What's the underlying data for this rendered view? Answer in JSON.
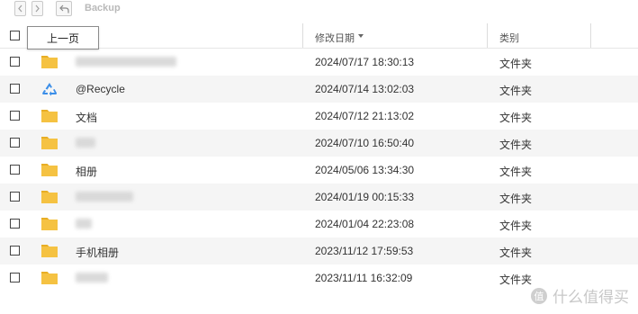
{
  "toolbar": {
    "back_label": "back",
    "forward_label": "forward",
    "up_label": "up",
    "path": "Backup"
  },
  "tooltip": {
    "label": "上一页"
  },
  "header": {
    "modified_label": "修改日期",
    "type_label": "类别"
  },
  "rows": [
    {
      "name": "",
      "date": "2024/07/17 18:30:13",
      "type": "文件夹",
      "icon": "folder-icon",
      "blurred": true
    },
    {
      "name": "@Recycle",
      "date": "2024/07/14 13:02:03",
      "type": "文件夹",
      "icon": "recycle-icon",
      "blurred": false
    },
    {
      "name": "文档",
      "date": "2024/07/12 21:13:02",
      "type": "文件夹",
      "icon": "folder-icon",
      "blurred": false
    },
    {
      "name": "",
      "date": "2024/07/10 16:50:40",
      "type": "文件夹",
      "icon": "folder-icon",
      "blurred": true
    },
    {
      "name": "相册",
      "date": "2024/05/06 13:34:30",
      "type": "文件夹",
      "icon": "folder-icon",
      "blurred": false
    },
    {
      "name": "",
      "date": "2024/01/19 00:15:33",
      "type": "文件夹",
      "icon": "folder-icon",
      "blurred": true
    },
    {
      "name": "",
      "date": "2024/01/04 22:23:08",
      "type": "文件夹",
      "icon": "folder-icon",
      "blurred": true
    },
    {
      "name": "手机相册",
      "date": "2023/11/12 17:59:53",
      "type": "文件夹",
      "icon": "folder-icon",
      "blurred": false
    },
    {
      "name": "",
      "date": "2023/11/11 16:32:09",
      "type": "文件夹",
      "icon": "folder-icon",
      "blurred": true
    }
  ],
  "watermark": {
    "text": "什么值得买",
    "logo": "值"
  },
  "colors": {
    "folder": "#f5c242",
    "folder_tab": "#e8ae25",
    "recycle": "#3b8ee8",
    "row_alt": "#f5f5f5"
  }
}
